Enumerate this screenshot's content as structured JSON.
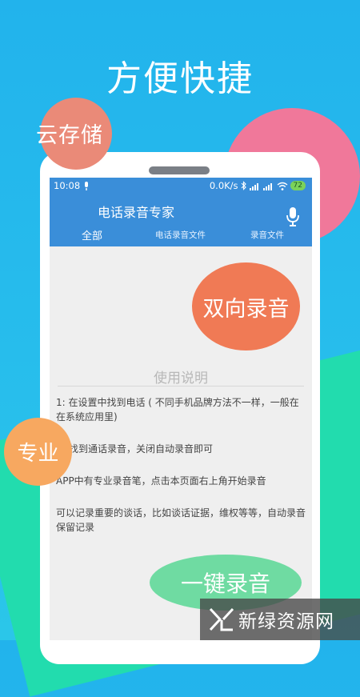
{
  "headline": "方便快捷",
  "bubbles": {
    "cloud": "云存储",
    "two_way": "双向录音",
    "pro": "专业",
    "one_key": "一键录音"
  },
  "status_bar": {
    "time": "10:08",
    "speed": "0.0K/s",
    "battery": "72"
  },
  "app": {
    "title": "电话录音专家",
    "tabs": [
      {
        "label": "全部"
      },
      {
        "label": "电话录音文件"
      },
      {
        "label": "录音文件"
      }
    ]
  },
  "instructions": {
    "title": "使用说明",
    "items": [
      "1: 在设置中找到电话 ( 不同手机品牌方法不一样，一般在在系统应用里)",
      "找到通话录音，关闭自动录音即可",
      "APP中有专业录音笔，点击本页面右上角开始录音",
      "可以记录重要的谈话，比如谈话证据，维权等等，自动录音保留记录"
    ]
  },
  "watermark": {
    "text": "新绿资源网"
  },
  "colors": {
    "background": "#22b3ec",
    "appbar": "#3a8ed9",
    "pink": "#f0789a",
    "orange": "#f07a55",
    "amber": "#f7a860",
    "mint": "#6fdba2",
    "green": "#22dcae"
  }
}
